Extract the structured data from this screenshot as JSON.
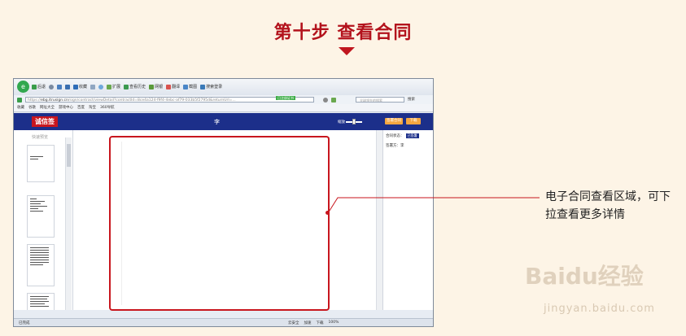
{
  "step": {
    "title": "第十步 查看合同"
  },
  "browser": {
    "toolbar": {
      "items": [
        "后退",
        "收藏",
        "扩展",
        "查看历史",
        "网银",
        "翻译",
        "截图",
        "搜索登录"
      ],
      "logo": "e"
    },
    "address": {
      "url_prefix": "https://",
      "host": "ebg.itrusign.cn",
      "url_rest": "/sign/contract/viewDetail?contractId=8ce4a124-f9f4-4ebc-af79-033b5f2795d&returnUrl=...",
      "tag": "已注册证书"
    },
    "search": {
      "placeholder": "全球领先的搜索",
      "button": "搜索"
    },
    "favorites": [
      "收藏",
      "谷歌",
      "网址大全",
      "游戏中心",
      "百度",
      "淘宝",
      "360导航"
    ]
  },
  "app": {
    "brand": "诚信签",
    "title": "李",
    "zoom_label": "缩放",
    "buttons": [
      "签署合同",
      "下载"
    ],
    "thumbs_label": "快速预览",
    "panel": {
      "status_label": "合同状态：",
      "status_value": "已签署",
      "signer_label": "签署方：李"
    }
  },
  "statusbar": {
    "left": "已完成",
    "right": [
      "云安全",
      "加速",
      "下载",
      "100%"
    ]
  },
  "callout": {
    "text": "电子合同查看区域，可下拉查看更多详情"
  },
  "watermark": {
    "main": "Baidu经验",
    "sub": "jingyan.baidu.com"
  },
  "colors": {
    "accent_red": "#c8161e",
    "header_blue": "#1c2f8a",
    "background": "#fdf4e6"
  }
}
